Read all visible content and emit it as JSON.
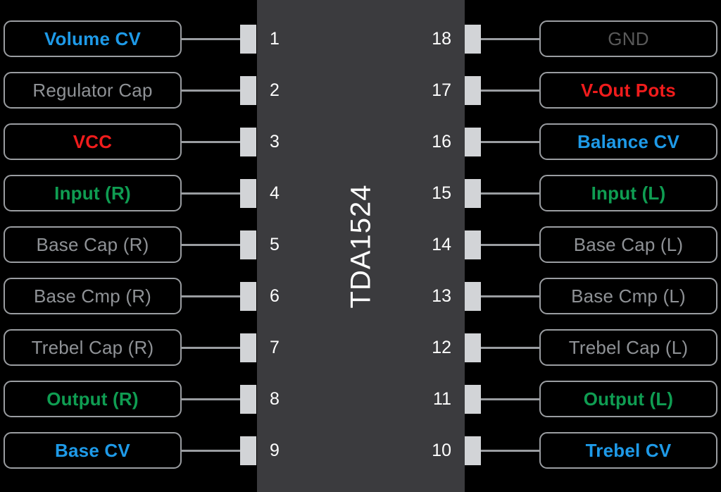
{
  "chip": {
    "part_number": "TDA1524",
    "body_color": "#3b3b3e",
    "notch": "top-center-semicircle",
    "pad_color": "#d2d4d7",
    "wire_color": "#9a9da1",
    "background_color": "#000000"
  },
  "palette": {
    "gray": "#8f9296",
    "dim_gray": "#595959",
    "blue": "#1e9ae8",
    "red": "#f01c1c",
    "green": "#0f9d52",
    "white": "#ffffff"
  },
  "left_pins": [
    {
      "number": "1",
      "label": "Volume CV",
      "color_class": "c-blue"
    },
    {
      "number": "2",
      "label": "Regulator Cap",
      "color_class": "c-gray"
    },
    {
      "number": "3",
      "label": "VCC",
      "color_class": "c-red"
    },
    {
      "number": "4",
      "label": "Input (R)",
      "color_class": "c-green"
    },
    {
      "number": "5",
      "label": "Base Cap (R)",
      "color_class": "c-gray"
    },
    {
      "number": "6",
      "label": "Base Cmp (R)",
      "color_class": "c-gray"
    },
    {
      "number": "7",
      "label": "Trebel Cap (R)",
      "color_class": "c-gray"
    },
    {
      "number": "8",
      "label": "Output (R)",
      "color_class": "c-green"
    },
    {
      "number": "9",
      "label": "Base CV",
      "color_class": "c-blue"
    }
  ],
  "right_pins": [
    {
      "number": "18",
      "label": "GND",
      "color_class": "c-dim"
    },
    {
      "number": "17",
      "label": "V-Out Pots",
      "color_class": "c-red"
    },
    {
      "number": "16",
      "label": "Balance CV",
      "color_class": "c-blue"
    },
    {
      "number": "15",
      "label": "Input (L)",
      "color_class": "c-green"
    },
    {
      "number": "14",
      "label": "Base Cap (L)",
      "color_class": "c-gray"
    },
    {
      "number": "13",
      "label": "Base Cmp (L)",
      "color_class": "c-gray"
    },
    {
      "number": "12",
      "label": "Trebel Cap (L)",
      "color_class": "c-gray"
    },
    {
      "number": "11",
      "label": "Output (L)",
      "color_class": "c-green"
    },
    {
      "number": "10",
      "label": "Trebel CV",
      "color_class": "c-blue"
    }
  ]
}
